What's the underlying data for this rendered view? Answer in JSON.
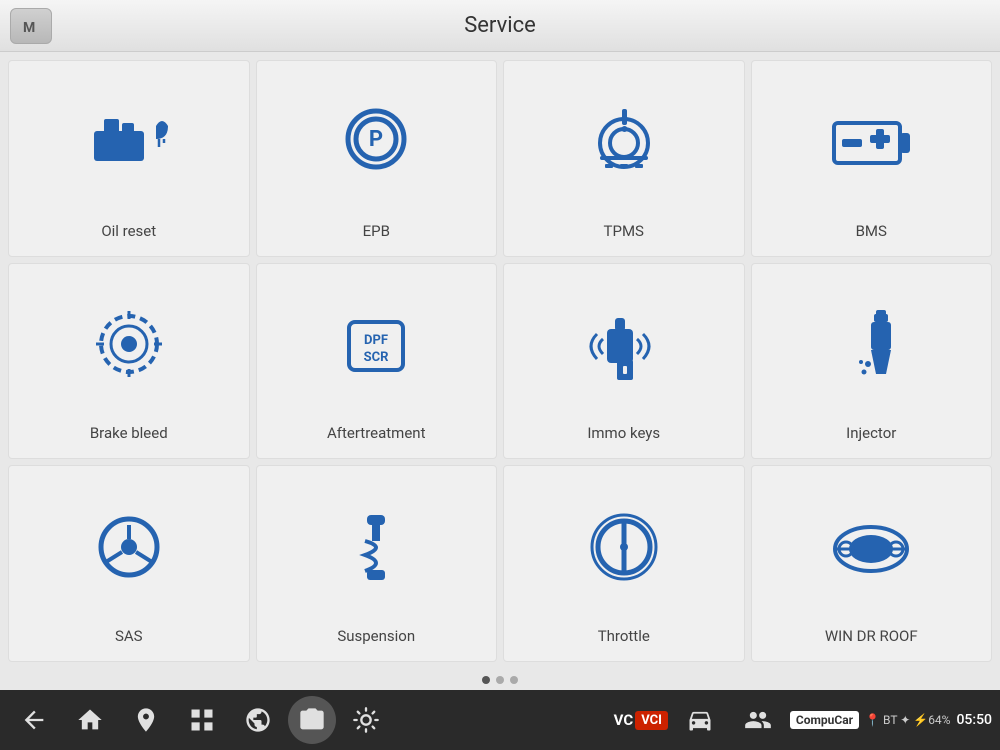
{
  "header": {
    "title": "Service",
    "home_button_label": "M"
  },
  "grid": {
    "rows": [
      [
        {
          "id": "oil-reset",
          "label": "Oil reset",
          "icon": "oil"
        },
        {
          "id": "epb",
          "label": "EPB",
          "icon": "epb"
        },
        {
          "id": "tpms",
          "label": "TPMS",
          "icon": "tpms"
        },
        {
          "id": "bms",
          "label": "BMS",
          "icon": "bms"
        }
      ],
      [
        {
          "id": "brake-bleed",
          "label": "Brake bleed",
          "icon": "brake"
        },
        {
          "id": "aftertreatment",
          "label": "Aftertreatment",
          "icon": "dpf"
        },
        {
          "id": "immo-keys",
          "label": "Immo keys",
          "icon": "immo"
        },
        {
          "id": "injector",
          "label": "Injector",
          "icon": "injector"
        }
      ],
      [
        {
          "id": "sas",
          "label": "SAS",
          "icon": "sas"
        },
        {
          "id": "suspension",
          "label": "Suspension",
          "icon": "suspension"
        },
        {
          "id": "throttle",
          "label": "Throttle",
          "icon": "throttle"
        },
        {
          "id": "win-dr-roof",
          "label": "WIN DR ROOF",
          "icon": "car-roof"
        }
      ]
    ]
  },
  "dots": {
    "total": 3,
    "active": 0
  },
  "bottom_bar": {
    "icons": [
      "back",
      "home",
      "home2",
      "square",
      "globe",
      "camera",
      "settings-sun",
      "vci",
      "car",
      "people"
    ],
    "vci_label": "VCI",
    "compucar_label": "CompuCar",
    "status": "BT ♦ 64%",
    "time": "05:50"
  }
}
